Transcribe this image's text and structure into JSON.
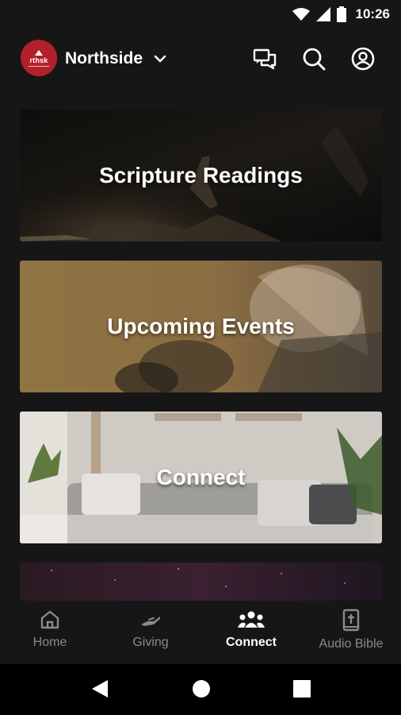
{
  "status": {
    "time": "10:26"
  },
  "header": {
    "logo_text": "rthsk",
    "church_name": "Northside"
  },
  "cards": [
    {
      "title": "Scripture Readings"
    },
    {
      "title": "Upcoming Events"
    },
    {
      "title": "Connect"
    }
  ],
  "nav": {
    "items": [
      {
        "label": "Home"
      },
      {
        "label": "Giving"
      },
      {
        "label": "Connect"
      },
      {
        "label": "Audio Bible"
      }
    ],
    "active_index": 2
  },
  "colors": {
    "background": "#161616",
    "brand": "#b3202a",
    "inactive": "#8a8a8a",
    "active": "#ffffff"
  },
  "icons": [
    "wifi-icon",
    "signal-icon",
    "battery-icon",
    "chevron-down-icon",
    "chat-icon",
    "search-icon",
    "account-icon",
    "home-icon",
    "giving-hand-icon",
    "group-icon",
    "bible-icon",
    "back-icon",
    "home-circle-icon",
    "recents-icon"
  ]
}
